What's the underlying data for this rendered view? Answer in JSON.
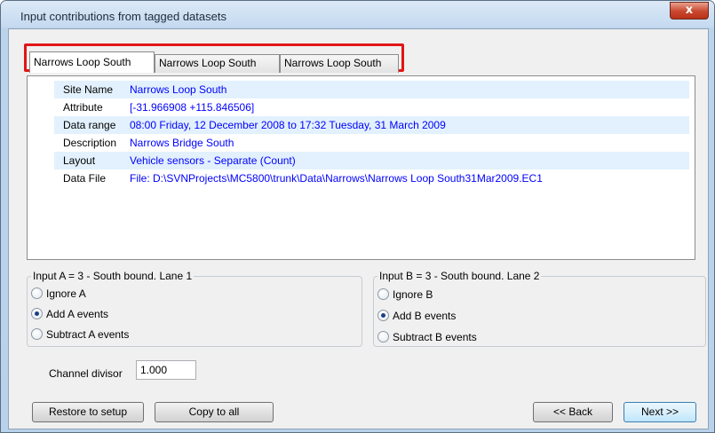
{
  "window": {
    "title": "Input contributions from tagged datasets",
    "close_label": "x"
  },
  "tabs": [
    {
      "label": "Narrows Loop South",
      "active": true
    },
    {
      "label": "Narrows Loop South",
      "active": false
    },
    {
      "label": "Narrows Loop South",
      "active": false
    }
  ],
  "info": [
    {
      "label": "Site Name",
      "value": "Narrows Loop South"
    },
    {
      "label": "Attribute",
      "value": "[-31.966908 +115.846506]"
    },
    {
      "label": "Data range",
      "value": "08:00 Friday, 12 December 2008 to 17:32 Tuesday, 31 March 2009"
    },
    {
      "label": "Description",
      "value": "Narrows Bridge South"
    },
    {
      "label": "Layout",
      "value": "Vehicle sensors - Separate (Count)"
    },
    {
      "label": "Data File",
      "value": "File: D:\\SVNProjects\\MC5800\\trunk\\Data\\Narrows\\Narrows Loop South31Mar2009.EC1"
    }
  ],
  "input_a": {
    "legend": "Input A = 3 - South bound. Lane 1",
    "options": [
      {
        "label": "Ignore A",
        "checked": false
      },
      {
        "label": "Add A events",
        "checked": true
      },
      {
        "label": "Subtract  A events",
        "checked": false
      }
    ]
  },
  "input_b": {
    "legend": "Input B = 3 - South bound. Lane 2",
    "options": [
      {
        "label": "Ignore B",
        "checked": false
      },
      {
        "label": "Add B events",
        "checked": true
      },
      {
        "label": "Subtract  B events",
        "checked": false
      }
    ]
  },
  "divisor": {
    "label": "Channel divisor",
    "value": "1.000"
  },
  "buttons": {
    "restore": "Restore to setup",
    "copy_all": "Copy to all",
    "back": "<< Back",
    "next": "Next >>"
  },
  "colors": {
    "value_text": "#0000ff",
    "highlight_frame": "#e11616",
    "row_alt": "#e2f1fd"
  }
}
